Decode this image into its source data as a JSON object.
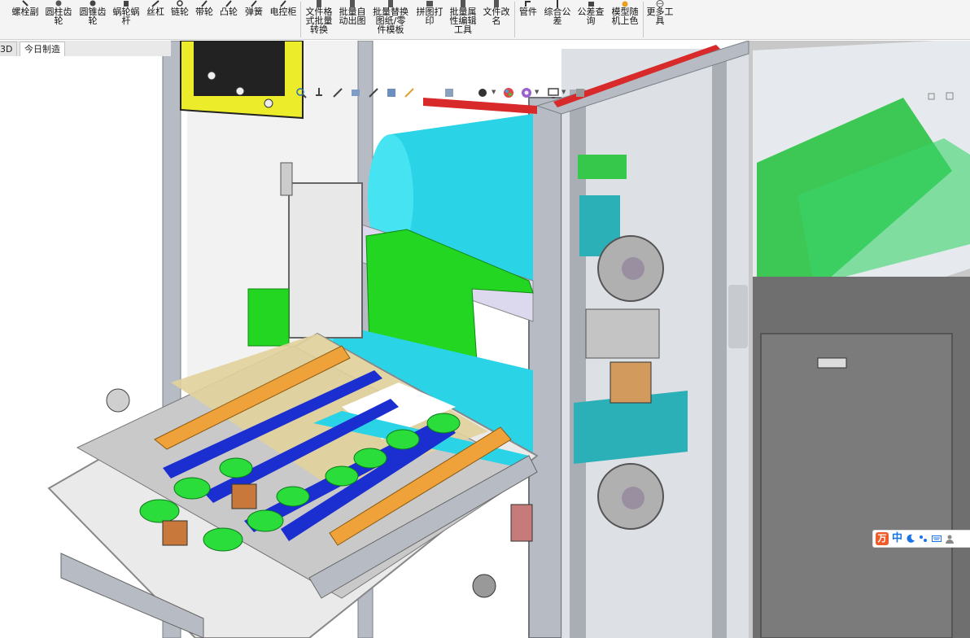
{
  "ribbon": {
    "items": [
      {
        "label": "螺栓副",
        "icon": "bolt-icon"
      },
      {
        "label": "圆柱齿\n轮",
        "icon": "spur-gear-icon"
      },
      {
        "label": "圆锥齿\n轮",
        "icon": "bevel-gear-icon"
      },
      {
        "label": "蜗轮蜗\n杆",
        "icon": "worm-gear-icon"
      },
      {
        "label": "丝杠",
        "icon": "lead-screw-icon"
      },
      {
        "label": "链轮",
        "icon": "sprocket-icon"
      },
      {
        "label": "带轮",
        "icon": "pulley-icon"
      },
      {
        "label": "凸轮",
        "icon": "cam-icon"
      },
      {
        "label": "弹簧",
        "icon": "spring-icon"
      },
      {
        "label": "电控柜",
        "icon": "cabinet-icon"
      },
      {
        "label": "文件格\n式批量\n转换",
        "icon": "file-convert-icon"
      },
      {
        "label": "批量自\n动出图",
        "icon": "batch-drawing-icon"
      },
      {
        "label": "批量替换\n图纸/零\n件模板",
        "icon": "template-replace-icon"
      },
      {
        "label": "拼图打\n印",
        "icon": "tile-print-icon"
      },
      {
        "label": "批量属\n性编辑\n工具",
        "icon": "property-edit-icon"
      },
      {
        "label": "文件改\n名",
        "icon": "file-rename-icon"
      },
      {
        "label": "管件",
        "icon": "pipe-icon"
      },
      {
        "label": "综合公\n差",
        "icon": "tolerance-icon"
      },
      {
        "label": "公差查\n询",
        "icon": "tolerance-query-icon"
      },
      {
        "label": "模型随\n机上色",
        "icon": "random-color-icon"
      },
      {
        "label": "更多工\n具",
        "icon": "more-tools-icon"
      }
    ]
  },
  "tabs": [
    {
      "label": "3D"
    },
    {
      "label": "今日制造"
    }
  ],
  "hud_icons": [
    "zoom-to-fit-icon",
    "zoom-area-icon",
    "previous-view-icon",
    "section-view-icon",
    "dynamic-annotation-icon",
    "view-orientation-icon",
    "display-style-icon",
    "hide-show-icon",
    "edit-appearance-icon",
    "apply-scene-icon",
    "view-settings-icon"
  ],
  "ime": {
    "logo": "万",
    "lang": "中",
    "icons": [
      "moon-icon",
      "punctuation-icon",
      "keyboard-icon",
      "user-icon"
    ]
  },
  "colors": {
    "frame": "#b7bcc4",
    "cyan_roller": "#2ad3e6",
    "green_sheet": "#22d622",
    "orange_bar": "#f0a23a",
    "blue_belt": "#1b2fd0",
    "yellow_panel": "#ecec2a"
  }
}
